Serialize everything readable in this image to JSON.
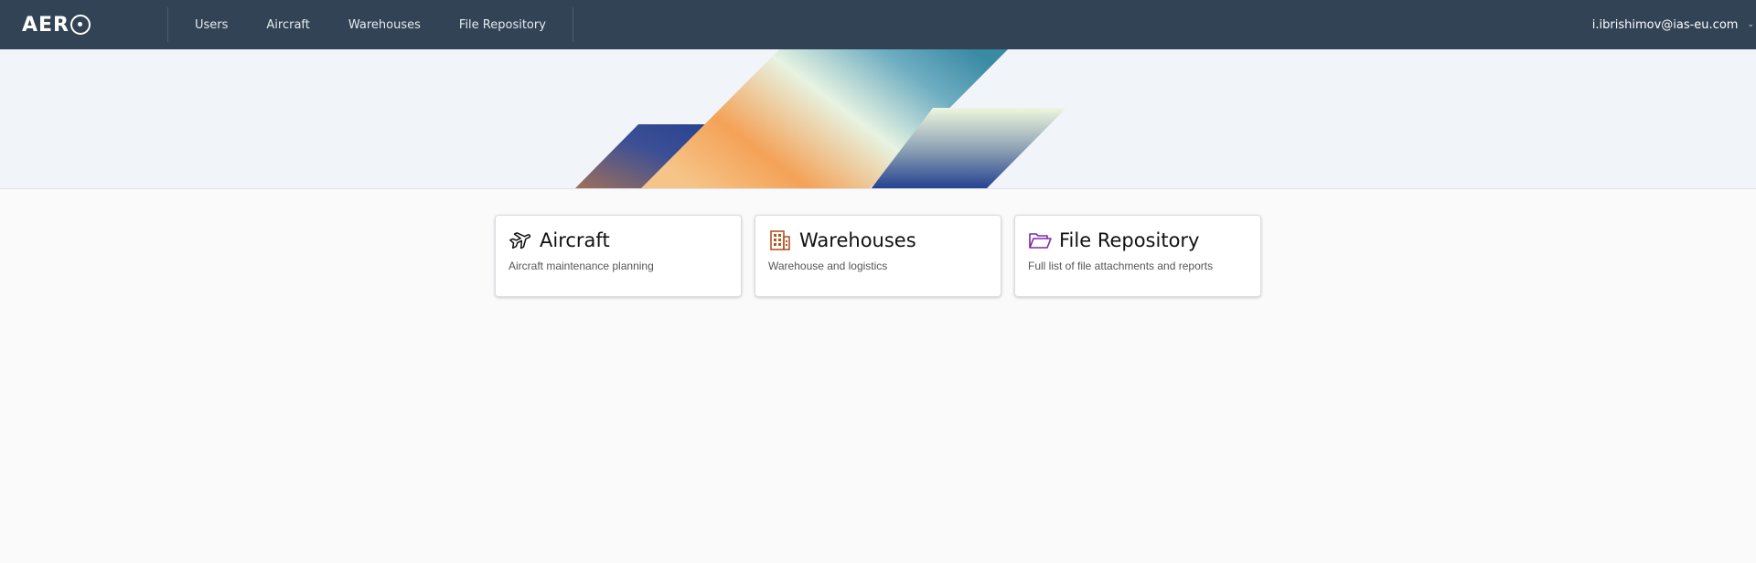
{
  "header": {
    "brand": "AER",
    "nav": [
      "Users",
      "Aircraft",
      "Warehouses",
      "File Repository"
    ],
    "user_email": "i.ibrishimov@ias-eu.com",
    "background_color": "#314354"
  },
  "cards": [
    {
      "title": "Aircraft",
      "description": "Aircraft maintenance planning",
      "icon": "plane-icon",
      "icon_color": "#111111"
    },
    {
      "title": "Warehouses",
      "description": "Warehouse and logistics",
      "icon": "building-icon",
      "icon_color": "#b8541f"
    },
    {
      "title": "File Repository",
      "description": "Full list of file attachments and reports",
      "icon": "folder-open-icon",
      "icon_color": "#7d2aa8"
    }
  ]
}
